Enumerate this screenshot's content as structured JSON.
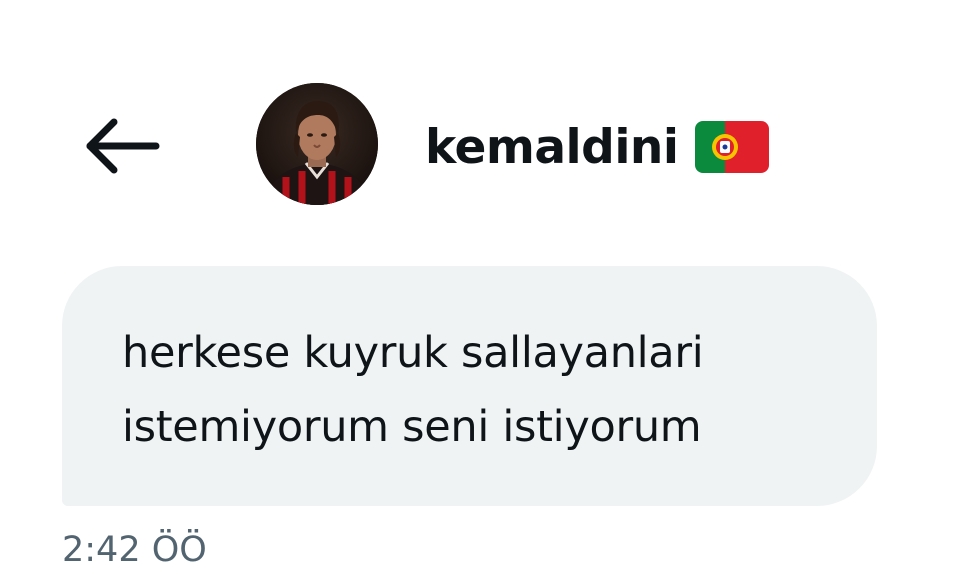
{
  "header": {
    "back_icon": "arrow-left-icon",
    "username": "kemaldini",
    "flag_icon": "portugal-flag-icon"
  },
  "message": {
    "lines": [
      "herkese kuyruk sallayanlari",
      "istemiyorum seni istiyorum"
    ],
    "timestamp": "2:42 ÖÖ"
  },
  "colors": {
    "bubble": "#eff3f4",
    "text": "#0f1419",
    "timestamp": "#536471"
  }
}
